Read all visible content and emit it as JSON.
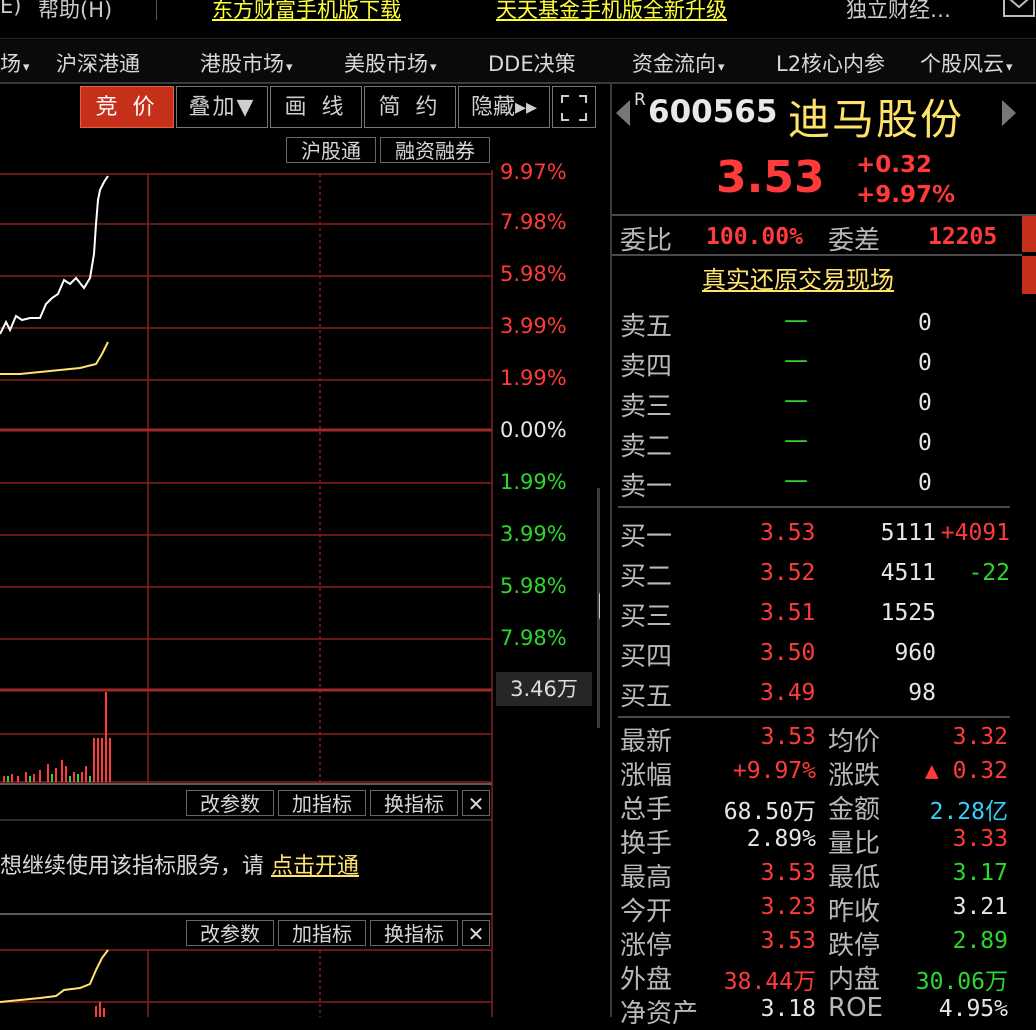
{
  "topbar": {
    "left_fragment": "E)",
    "help": "帮助(H)",
    "link1": "东方财富手机版下载",
    "link2": "天天基金手机版全新升级",
    "right_text": "独立财经…",
    "mail_icon": "envelope-icon"
  },
  "menu": {
    "frag": "场",
    "items": [
      "沪深港通",
      "港股市场",
      "美股市场",
      "DDE决策",
      "资金流向",
      "L2核心内参",
      "个股风云"
    ]
  },
  "toolbar": {
    "auction": "竞 价",
    "overlay": "叠加▼",
    "draw": "画 线",
    "simple": "简 约",
    "hide": "隐藏▸▸",
    "fullscreen_icon": "expand-icon"
  },
  "tags": {
    "hsgt": "沪股通",
    "margin": "融资融券"
  },
  "pct_labels": {
    "up": [
      "9.97%",
      "7.98%",
      "5.98%",
      "3.99%",
      "1.99%"
    ],
    "zero": "0.00%",
    "down": [
      "1.99%",
      "3.99%",
      "5.98%",
      "7.98%"
    ],
    "volume_max": "3.46万"
  },
  "indicator_bar": {
    "change_param": "改参数",
    "add_ind": "加指标",
    "swap_ind": "换指标",
    "close": "✕"
  },
  "notice": {
    "text": "想继续使用该指标服务，请",
    "link": "点击开通"
  },
  "stock": {
    "r": "R",
    "code": "600565",
    "name": "迪马股份",
    "price": "3.53",
    "change": "+0.32",
    "change_pct": "+9.97%"
  },
  "ratio": {
    "wb_label": "委比",
    "wb": "100.00%",
    "wc_label": "委差",
    "wc": "12205"
  },
  "real_link": "真实还原交易现场",
  "sells": [
    {
      "label": "卖五",
      "price": "—",
      "vol": "0"
    },
    {
      "label": "卖四",
      "price": "—",
      "vol": "0"
    },
    {
      "label": "卖三",
      "price": "—",
      "vol": "0"
    },
    {
      "label": "卖二",
      "price": "—",
      "vol": "0"
    },
    {
      "label": "卖一",
      "price": "—",
      "vol": "0"
    }
  ],
  "buys": [
    {
      "label": "买一",
      "price": "3.53",
      "vol": "5111",
      "delta": "+4091"
    },
    {
      "label": "买二",
      "price": "3.52",
      "vol": "4511",
      "delta": "-22"
    },
    {
      "label": "买三",
      "price": "3.51",
      "vol": "1525",
      "delta": ""
    },
    {
      "label": "买四",
      "price": "3.50",
      "vol": "960",
      "delta": ""
    },
    {
      "label": "买五",
      "price": "3.49",
      "vol": "98",
      "delta": ""
    }
  ],
  "stats": [
    {
      "l1": "最新",
      "v1": "3.53",
      "l2": "均价",
      "v2": "3.32"
    },
    {
      "l1": "涨幅",
      "v1": "+9.97%",
      "l2": "涨跌",
      "v2": "▲ 0.32"
    },
    {
      "l1": "总手",
      "v1": "68.50万",
      "l2": "金额",
      "v2": "2.28亿"
    },
    {
      "l1": "换手",
      "v1": "2.89%",
      "l2": "量比",
      "v2": "3.33"
    },
    {
      "l1": "最高",
      "v1": "3.53",
      "l2": "最低",
      "v2": "3.17"
    },
    {
      "l1": "今开",
      "v1": "3.23",
      "l2": "昨收",
      "v2": "3.21"
    },
    {
      "l1": "涨停",
      "v1": "3.53",
      "l2": "跌停",
      "v2": "2.89"
    },
    {
      "l1": "外盘",
      "v1": "38.44万",
      "l2": "内盘",
      "v2": "30.06万"
    },
    {
      "l1": "净资产",
      "v1": "3.18",
      "l2": "ROE",
      "v2": "4.95%"
    }
  ],
  "colors": {
    "up": "#ff3a3a",
    "down": "#2bd82b",
    "price_line": "#ffffff",
    "avg_line": "#ffe36b",
    "accent": "#c6301a"
  }
}
